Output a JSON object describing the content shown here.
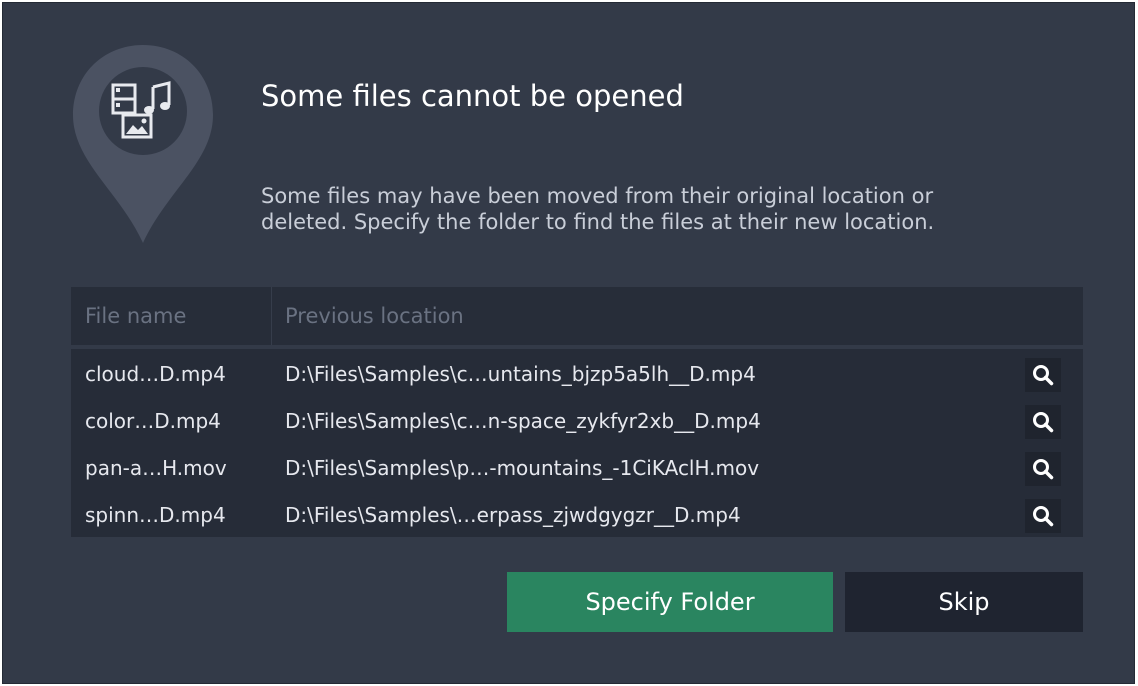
{
  "dialog": {
    "title": "Some files cannot be opened",
    "description_line1": "Some files may have been moved from their original location or",
    "description_line2": "deleted. Specify the folder to find the files at their new location."
  },
  "table": {
    "headers": {
      "file_name": "File name",
      "previous_location": "Previous location"
    },
    "rows": [
      {
        "file_name": "cloud…D.mp4",
        "location": "D:\\Files\\Samples\\c…untains_bjzp5a5lh__D.mp4"
      },
      {
        "file_name": "color…D.mp4",
        "location": "D:\\Files\\Samples\\c…n-space_zykfyr2xb__D.mp4"
      },
      {
        "file_name": "pan-a…H.mov",
        "location": "D:\\Files\\Samples\\p…-mountains_-1CiKAclH.mov"
      },
      {
        "file_name": "spinn…D.mp4",
        "location": "D:\\Files\\Samples\\…erpass_zjwdgygzr__D.mp4"
      }
    ]
  },
  "buttons": {
    "specify_folder": "Specify Folder",
    "skip": "Skip"
  },
  "icons": {
    "header_icon": "media-files-pin-icon",
    "row_action": "search-icon"
  },
  "colors": {
    "dialog_bg": "#333a48",
    "primary_button": "#2a8560",
    "secondary_button": "#1f2430"
  }
}
